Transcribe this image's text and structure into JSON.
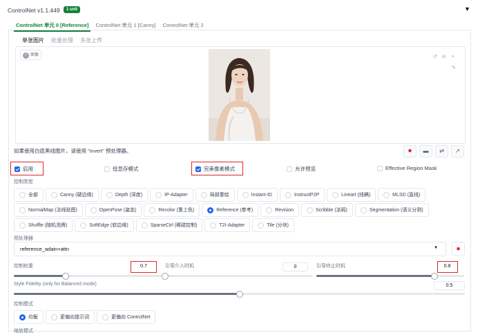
{
  "header": {
    "title": "ControlNet v1.1.449",
    "badge": "1 unit"
  },
  "unit_tabs": [
    "ControlNet 单元 0 [Reference]",
    "ControlNet 单元 1 [Canny]",
    "ControlNet 单元 2"
  ],
  "sub_tabs": [
    "单张图片",
    "批量处理",
    "多张上传"
  ],
  "image_panel": {
    "label": "图像"
  },
  "invert_note": "如果使用白底黑线图片，请使用 \"invert\" 预处理器。",
  "checkboxes": [
    {
      "label": "启用",
      "checked": true
    },
    {
      "label": "低显存模式",
      "checked": false
    },
    {
      "label": "完美像素模式",
      "checked": true
    },
    {
      "label": "允许预览",
      "checked": false
    },
    {
      "label": "Effective Region Mask",
      "checked": false
    }
  ],
  "control_type": {
    "label": "控制类型",
    "rows": [
      [
        "全部",
        "Canny (硬边缘)",
        "Depth (深度)",
        "IP-Adapter",
        "局部重绘",
        "Instant-ID",
        "InstructP2P",
        "Lineart (线稿)",
        "MLSD (直线)"
      ],
      [
        "NormalMap (法线贴图)",
        "OpenPose (姿态)",
        "Recolor (重上色)",
        "Reference (参考)",
        "Revision",
        "Scribble (涂鸦)",
        "Segmentation (语义分割)"
      ],
      [
        "Shuffle (随机洗牌)",
        "SoftEdge (软边缘)",
        "SparseCtrl (稀疏控制)",
        "T2I-Adapter",
        "Tile (分块)"
      ]
    ],
    "selected": "Reference (参考)"
  },
  "preprocessor": {
    "label": "预处理器",
    "value": "reference_adain+attn"
  },
  "sliders": {
    "weight": {
      "label": "控制权重",
      "value": "0.7",
      "fraction": 0.35
    },
    "start": {
      "label": "引导介入时机",
      "value": "0",
      "fraction": 0.0
    },
    "end": {
      "label": "引导终止时机",
      "value": "0.8",
      "fraction": 0.8
    },
    "fidelity": {
      "label": "Style Fidelity (only for Balanced mode)",
      "value": "0.5",
      "fraction": 0.5
    }
  },
  "control_mode": {
    "label": "控制模式",
    "options": [
      "均衡",
      "更偏向提示词",
      "更偏向 ControlNet"
    ],
    "selected": "均衡"
  },
  "resize_mode_label": "缩放模式",
  "colors": {
    "accent": "#15803d",
    "checkbox": "#2563eb",
    "highlight": "#dc2626"
  }
}
